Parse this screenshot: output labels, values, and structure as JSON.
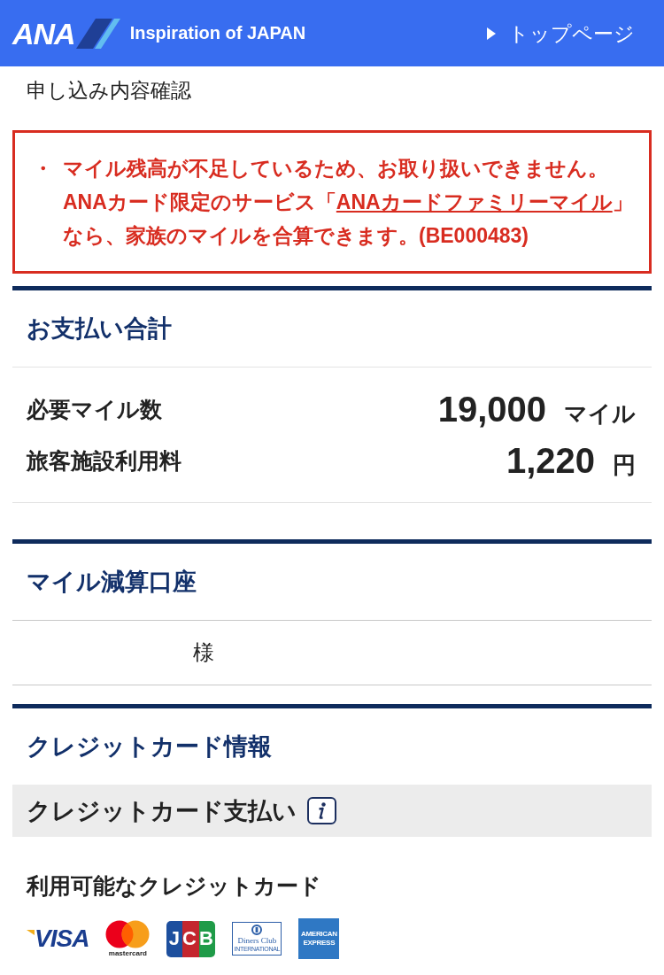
{
  "header": {
    "logo_text": "ANA",
    "tagline": "Inspiration of JAPAN",
    "top_link": "トップページ"
  },
  "page_title": "申し込み内容確認",
  "error": {
    "bullet": "・",
    "message": "マイル残高が不足しているため、お取り扱いできません。",
    "note_before": "ANAカード限定のサービス「",
    "link": "ANAカードファミリーマイル",
    "note_after": "」なら、家族のマイルを合算できます。(BE000483)"
  },
  "sections": [
    {
      "kind": "totals",
      "title": "お支払い合計",
      "rows": [
        {
          "label": "必要マイル数",
          "value": "19,000",
          "unit": "マイル"
        },
        {
          "label": "旅客施設利用料",
          "value": "1,220",
          "unit": "円"
        }
      ]
    },
    {
      "kind": "account",
      "title": "マイル減算口座",
      "name_suffix": "様"
    },
    {
      "kind": "credit",
      "title": "クレジットカード情報",
      "subheading": "クレジットカード支払い",
      "cards_title": "利用可能なクレジットカード",
      "cards": [
        {
          "kind": "visa",
          "label": "VISA"
        },
        {
          "kind": "mastercard",
          "label": "mastercard"
        },
        {
          "kind": "jcb",
          "label": "JCB"
        },
        {
          "kind": "diners",
          "label": "Diners Club",
          "sublabel": "INTERNATIONAL"
        },
        {
          "kind": "amex",
          "label": "AMERICAN EXPRESS"
        }
      ]
    }
  ]
}
